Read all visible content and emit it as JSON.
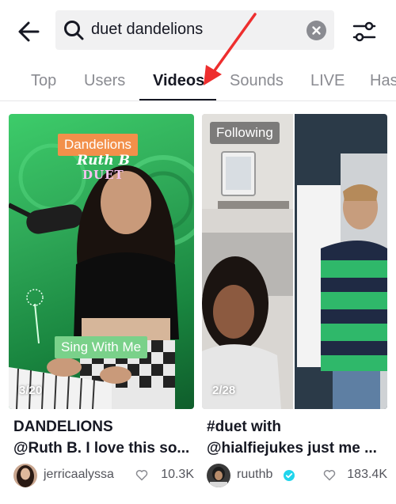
{
  "search": {
    "query": "duet dandelions"
  },
  "tabs": [
    {
      "label": "Top"
    },
    {
      "label": "Users"
    },
    {
      "label": "Videos"
    },
    {
      "label": "Sounds"
    },
    {
      "label": "LIVE"
    },
    {
      "label": "Has"
    }
  ],
  "active_tab": "Videos",
  "colors": {
    "accent_arrow": "#ee2e2e",
    "text_primary": "#161823",
    "text_secondary": "#8a8b91",
    "verified": "#20d5ec"
  },
  "cards": [
    {
      "overlay_top": "Dandelions",
      "overlay_script": "Ruth B",
      "overlay_duet": "DUET",
      "overlay_bottom": "Sing With Me",
      "counter": "3/20",
      "title": "DANDELIONS",
      "description": "@Ruth B. I love this so...",
      "username": "jerricaalyssa",
      "likes": "10.3K",
      "verified": false
    },
    {
      "badge": "Following",
      "counter": "2/28",
      "title": "#duet with",
      "description": "@hialfiejukes just me ...",
      "username": "ruuthb",
      "likes": "183.4K",
      "verified": true
    }
  ],
  "icons": {
    "back": "arrow-left-icon",
    "search": "search-icon",
    "clear": "close-circle-icon",
    "filter": "sliders-icon",
    "like": "heart-icon",
    "verified": "verified-check-icon"
  }
}
